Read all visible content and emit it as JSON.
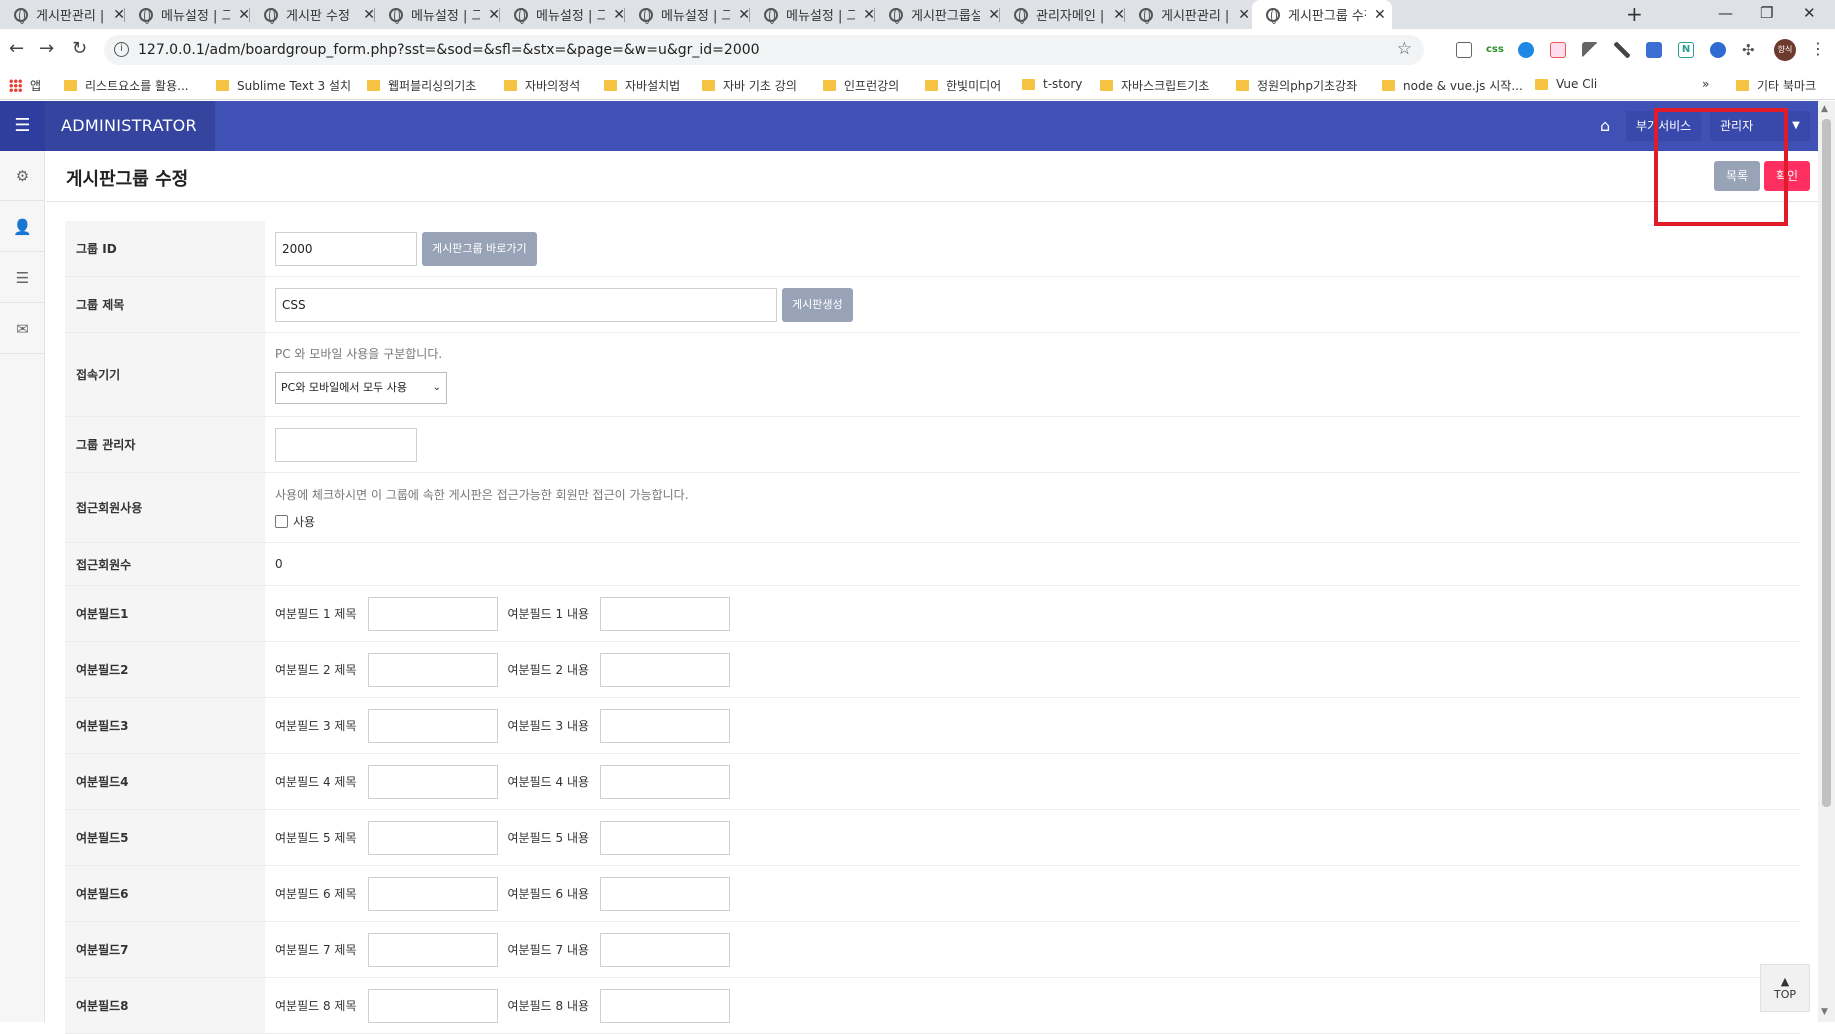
{
  "browser": {
    "tabs": [
      {
        "label": "게시판관리 | 그"
      },
      {
        "label": "메뉴설정 | 그누"
      },
      {
        "label": "게시판 수정 | 그"
      },
      {
        "label": "메뉴설정 | 그누"
      },
      {
        "label": "메뉴설정 | 그누"
      },
      {
        "label": "메뉴설정 | 그누"
      },
      {
        "label": "메뉴설정 | 그누"
      },
      {
        "label": "게시판그룹설정"
      },
      {
        "label": "관리자메인 | 그"
      },
      {
        "label": "게시판관리 | 그"
      },
      {
        "label": "게시판그룹 수정"
      }
    ],
    "url": "127.0.0.1/adm/boardgroup_form.php?sst=&sod=&sfl=&stx=&page=&w=u&gr_id=2000",
    "profile_initials": "향식",
    "bookmarks": [
      {
        "label": "앱"
      },
      {
        "label": "리스트요소를 활용..."
      },
      {
        "label": "Sublime Text 3 설치"
      },
      {
        "label": "웹퍼블리싱의기초"
      },
      {
        "label": "자바의정석"
      },
      {
        "label": "자바설치법"
      },
      {
        "label": "자바 기초 강의"
      },
      {
        "label": "인프런강의"
      },
      {
        "label": "한빛미디어"
      },
      {
        "label": "t-story"
      },
      {
        "label": "자바스크립트기초"
      },
      {
        "label": "정원의php기초강좌"
      },
      {
        "label": "node & vue.js 시작..."
      },
      {
        "label": "Vue Cli"
      }
    ],
    "more_bookmarks": "»",
    "other_bookmarks": "기타 북마크"
  },
  "admin": {
    "brand": "ADMINISTRATOR",
    "extra_service": "부가서비스",
    "admin_menu": "관리자",
    "page_title": "게시판그룹 수정",
    "list_button": "목록",
    "confirm_button": "확인",
    "top_button": "TOP"
  },
  "form": {
    "group_id": {
      "label": "그룹 ID",
      "value": "2000",
      "button": "게시판그룹 바로가기"
    },
    "group_subject": {
      "label": "그룹 제목",
      "value": "CSS",
      "button": "게시판생성"
    },
    "device": {
      "label": "접속기기",
      "help": "PC 와 모바일 사용을 구분합니다.",
      "selected": "PC와 모바일에서 모두 사용"
    },
    "group_admin": {
      "label": "그룹 관리자",
      "value": ""
    },
    "member_access": {
      "label": "접근회원사용",
      "help": "사용에 체크하시면 이 그룹에 속한 게시판은 접근가능한 회원만 접근이 가능합니다.",
      "checkbox_label": "사용"
    },
    "member_count": {
      "label": "접근회원수",
      "value": "0"
    },
    "extra_fields": [
      {
        "label": "여분필드1",
        "subject_label": "여분필드 1 제목",
        "value_label": "여분필드 1 내용"
      },
      {
        "label": "여분필드2",
        "subject_label": "여분필드 2 제목",
        "value_label": "여분필드 2 내용"
      },
      {
        "label": "여분필드3",
        "subject_label": "여분필드 3 제목",
        "value_label": "여분필드 3 내용"
      },
      {
        "label": "여분필드4",
        "subject_label": "여분필드 4 제목",
        "value_label": "여분필드 4 내용"
      },
      {
        "label": "여분필드5",
        "subject_label": "여분필드 5 제목",
        "value_label": "여분필드 5 내용"
      },
      {
        "label": "여분필드6",
        "subject_label": "여분필드 6 제목",
        "value_label": "여분필드 6 내용"
      },
      {
        "label": "여분필드7",
        "subject_label": "여분필드 7 제목",
        "value_label": "여분필드 7 내용"
      },
      {
        "label": "여분필드8",
        "subject_label": "여분필드 8 제목",
        "value_label": "여분필드 8 내용"
      }
    ]
  },
  "colors": {
    "topbar": "#3f51b5",
    "confirm": "#ff3061",
    "gray_button": "#98a3b8",
    "highlight_box": "#e21b2b"
  }
}
